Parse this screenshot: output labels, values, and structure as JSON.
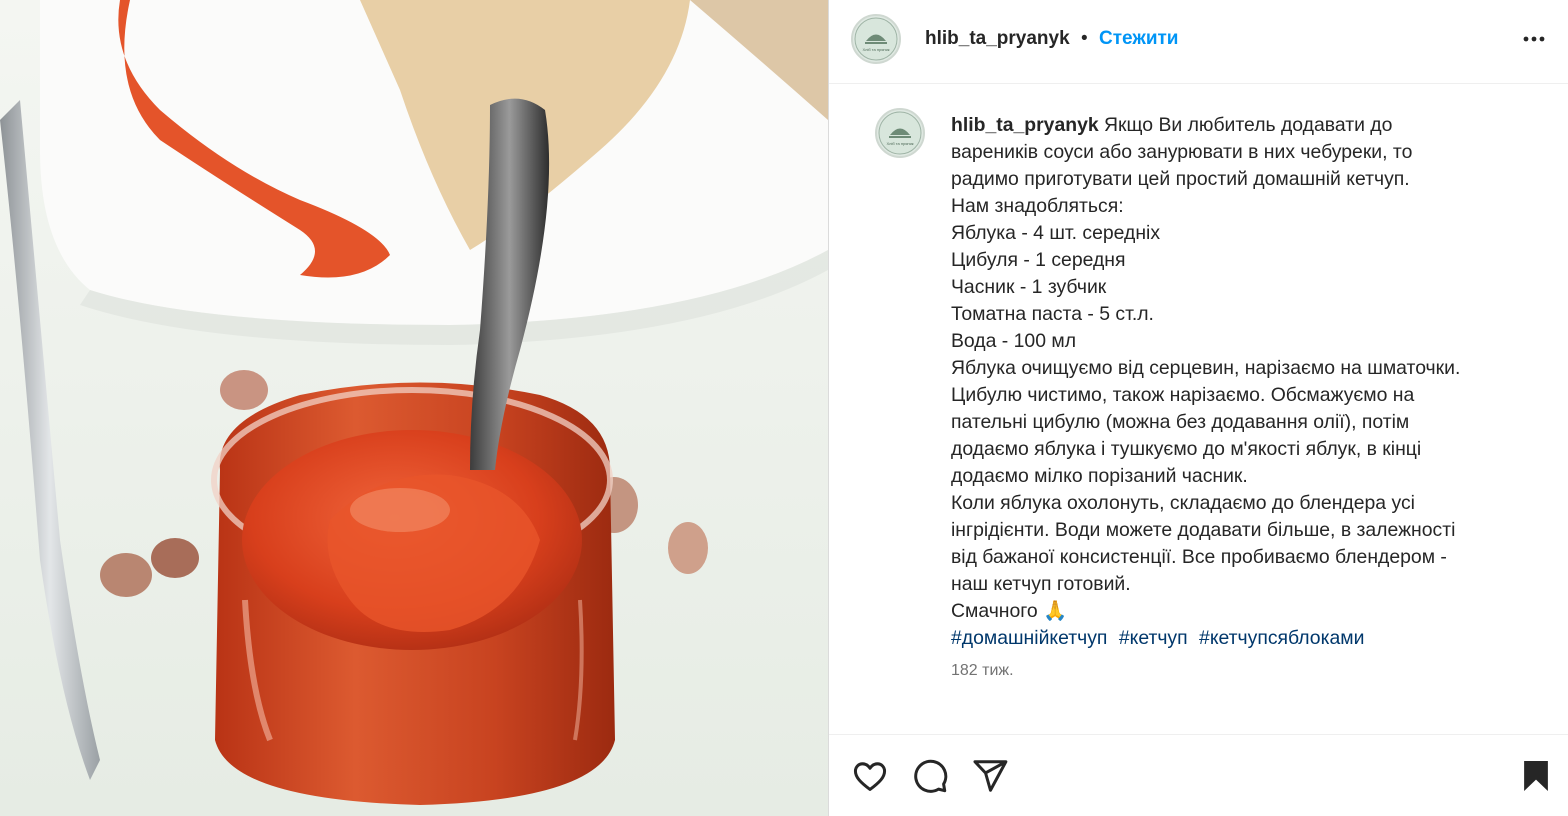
{
  "post": {
    "username": "hlib_ta_pryanyk",
    "separator": "•",
    "follow_label": "Стежити",
    "more_icon": "more-horizontal-icon",
    "avatar_text": "Хліб та пряник",
    "caption_lines": [
      "Якщо Ви любитель додавати до",
      "вареників соуси або занурювати в них чебуреки, то",
      "радимо приготувати цей простий домашній кетчуп.",
      "Нам знадобляться:",
      "Яблука - 4 шт. середніх",
      "Цибуля - 1 середня",
      "Часник - 1 зубчик",
      "Томатна паста - 5 ст.л.",
      "Вода - 100 мл",
      "Яблука очищуємо від серцевин, нарізаємо на шматочки.",
      "Цибулю чистимо, також нарізаємо. Обсмажуємо на",
      "пательні цибулю (можна без додавання олії), потім",
      "додаємо яблука і тушкуємо до м'якості яблук, в кінці",
      "додаємо мілко порізаний часник.",
      "Коли яблука охолонуть, складаємо до блендера усі",
      "інгрідієнти. Води можете додавати більше, в залежності",
      "від бажаної консистенції. Все пробиваємо блендером -",
      "наш кетчуп готовий.",
      "Смачного 🙏"
    ],
    "hashtags": [
      "#домашнійкетчуп",
      "#кетчуп",
      "#кетчупсяблоками"
    ],
    "timestamp": "182 тиж."
  },
  "actions": {
    "like_icon": "heart-icon",
    "comment_icon": "comment-icon",
    "share_icon": "share-icon",
    "save_icon": "bookmark-icon"
  },
  "colors": {
    "link": "#0095f6",
    "hashtag": "#00376b",
    "muted": "#737373",
    "text": "#262626"
  }
}
